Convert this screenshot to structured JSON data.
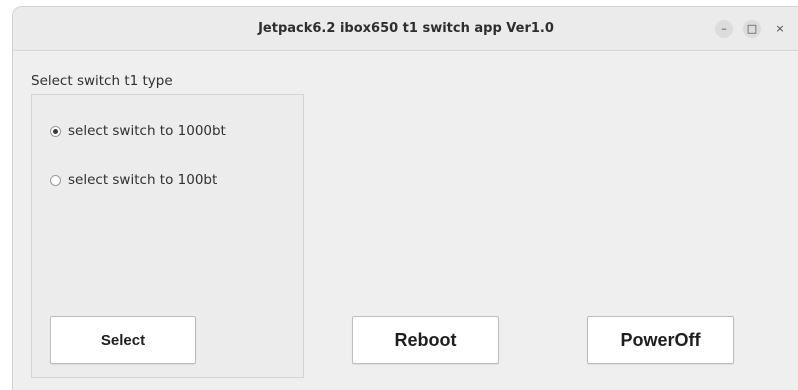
{
  "window": {
    "title": "Jetpack6.2 ibox650 t1 switch app Ver1.0",
    "controls": {
      "minimize": "–",
      "maximize": "□",
      "close": "×"
    }
  },
  "group": {
    "label": "Select switch t1 type",
    "options": [
      {
        "label": "select switch to 1000bt",
        "checked": true
      },
      {
        "label": "select switch to 100bt",
        "checked": false
      }
    ],
    "select_label": "Select"
  },
  "actions": {
    "reboot_label": "Reboot",
    "poweroff_label": "PowerOff"
  }
}
